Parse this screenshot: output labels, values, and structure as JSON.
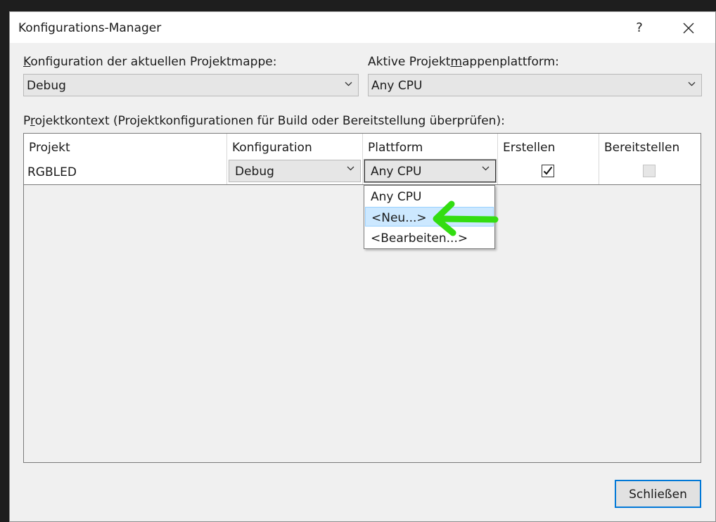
{
  "window": {
    "title": "Konfigurations-Manager",
    "help_label": "?",
    "close_icon": "close-icon"
  },
  "solution_config": {
    "label_first": "K",
    "label_rest": "onfiguration der aktuellen Projektmappe:",
    "value": "Debug"
  },
  "solution_platform": {
    "label_pre": "Aktive Projekt",
    "label_mn": "m",
    "label_post": "appenplattform:",
    "value": "Any CPU"
  },
  "project_context": {
    "label_pre": "P",
    "label_r": "r",
    "label_post": "ojektkontext (Projektkonfigurationen für Build oder Bereitstellung überprüfen):"
  },
  "grid": {
    "columns": [
      "Projekt",
      "Konfiguration",
      "Plattform",
      "Erstellen",
      "Bereitstellen"
    ],
    "rows": [
      {
        "project": "RGBLED",
        "configuration": "Debug",
        "platform": "Any CPU",
        "build": true,
        "deploy": false
      }
    ]
  },
  "platform_dropdown": {
    "options": [
      "Any CPU",
      "<Neu...>",
      "<Bearbeiten...>"
    ],
    "highlighted_index": 1
  },
  "annotation": {
    "arrow_color": "#33dd11",
    "icon": "green-arrow-icon"
  },
  "footer": {
    "close_label": "Schließen"
  },
  "colors": {
    "accent": "#0078d7",
    "highlight": "#cce8ff"
  }
}
